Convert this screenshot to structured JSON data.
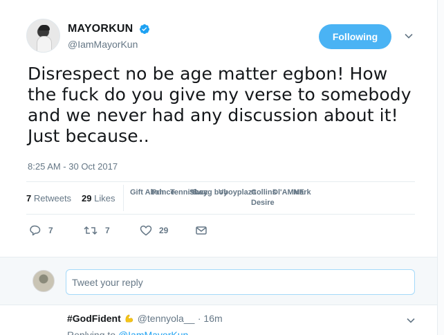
{
  "tweet": {
    "author": {
      "display_name": "MAYORKUN",
      "handle": "@IamMayorKun",
      "verified": true,
      "avatar_icon": "user-avatar"
    },
    "follow_button_label": "Following",
    "text": "Disrespect no be age matter egbon! How the fuck do you give my verse to somebody and we never had any discussion about it! Just because..",
    "timestamp": "8:25 AM - 30 Oct 2017",
    "stats": {
      "retweets_count": "7",
      "retweets_label": "Retweets",
      "likes_count": "29",
      "likes_label": "Likes"
    },
    "likers": [
      "Gift Abah",
      "Prince",
      "Tennisboy",
      "Shay",
      "Swag boy",
      "Vboyplaza",
      "Collins",
      "Desire",
      "Dl'AMNE",
      "Mark"
    ],
    "actions": {
      "reply_count": "7",
      "retweet_count": "7",
      "like_count": "29"
    }
  },
  "reply_box": {
    "placeholder": "Tweet your reply"
  },
  "reply_tweet": {
    "display_name": "#GodFident",
    "emoji_icon": "flexed-biceps-icon",
    "handle": "@tennyola__",
    "time": "· 16m",
    "replying_to_label": "Replying to",
    "replying_to_handle": "@IamMayorKun"
  },
  "colors": {
    "accent": "#1da1f2",
    "follow_button": "#4ab3f4",
    "muted_text": "#657786",
    "body_text": "#14171a",
    "border": "#e6ecf0"
  }
}
